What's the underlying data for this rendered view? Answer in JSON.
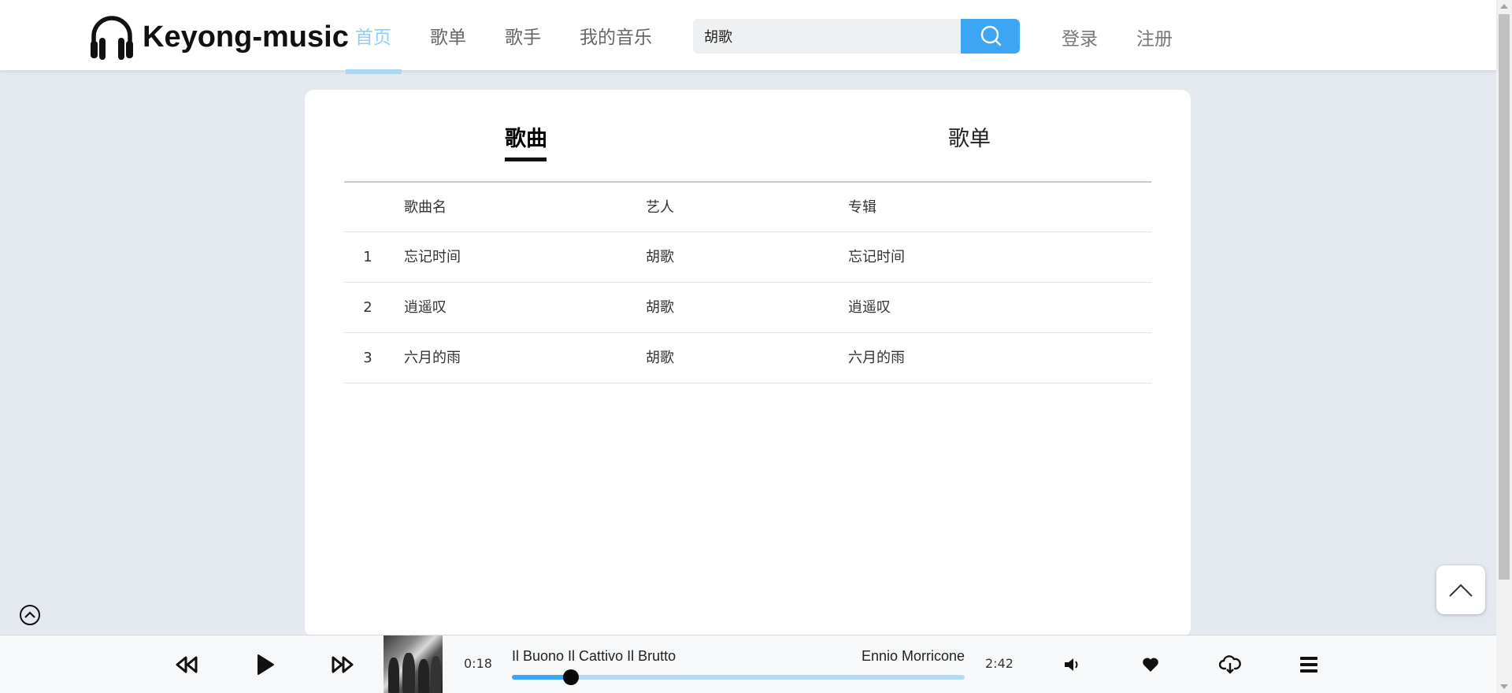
{
  "header": {
    "logo_text": "Keyong-music",
    "nav": [
      {
        "label": "首页",
        "active": true
      },
      {
        "label": "歌单",
        "active": false
      },
      {
        "label": "歌手",
        "active": false
      },
      {
        "label": "我的音乐",
        "active": false
      }
    ],
    "search": {
      "value": "胡歌"
    },
    "login_label": "登录",
    "register_label": "注册"
  },
  "results": {
    "tabs": [
      {
        "label": "歌曲",
        "active": true
      },
      {
        "label": "歌单",
        "active": false
      }
    ],
    "columns": [
      "歌曲名",
      "艺人",
      "专辑"
    ],
    "rows": [
      {
        "index": "1",
        "name": "忘记时间",
        "artist": "胡歌",
        "album": "忘记时间"
      },
      {
        "index": "2",
        "name": "逍遥叹",
        "artist": "胡歌",
        "album": "逍遥叹"
      },
      {
        "index": "3",
        "name": "六月的雨",
        "artist": "胡歌",
        "album": "六月的雨"
      }
    ]
  },
  "player": {
    "current_time": "0:18",
    "duration": "2:42",
    "progress_fraction": 0.13,
    "title": "Il Buono Il Cattivo Il Brutto",
    "artist": "Ennio Morricone",
    "icons": [
      "rewind-icon",
      "play-icon",
      "fast-forward-icon",
      "volume-icon",
      "heart-icon",
      "cloud-download-icon",
      "playlist-menu-icon"
    ]
  },
  "colors": {
    "accent": "#3ca6f4",
    "nav_active": "#8fd0f2",
    "progress_track": "#b3dbf3",
    "page_background": "#e4e9f0"
  }
}
